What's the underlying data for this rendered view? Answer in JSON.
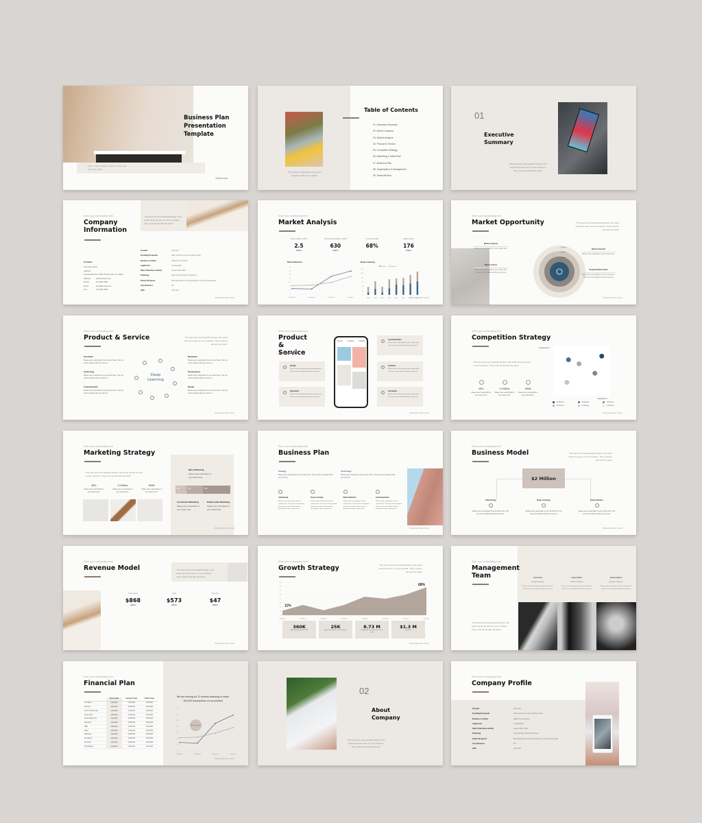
{
  "common": {
    "subheading": "Enter your subheading here",
    "quote": "\"The best and most beautiful things in the world cannot be seen or even touched - They must be felt with the heart\"",
    "footer": "Presentation title / Footer",
    "desc_short": "Please enter a description of your content here.",
    "desc_long": "Please enter a description of your content here. This text can be replaced with your own text.",
    "colors": {
      "accent": "#8a7a6c",
      "blue": "#3f6483",
      "beige": "#ece8e3",
      "taupe": "#b3a69c"
    }
  },
  "slides": {
    "cover": {
      "title": "Business Plan Presentation Template",
      "subtitle": "Enter a slide subtitle or author's name here",
      "date": "March 20, 20XX",
      "logo": "YOUR LOGO"
    },
    "toc": {
      "title": "Table of Contents",
      "caption": "\"The secret to happiness is life is the conviction that we are loved\"",
      "items": [
        "01. Executive Summary",
        "02. About Company",
        "03. Market Analysis",
        "04. Product & Service",
        "05. Competitor Strategy",
        "06. Marketing & Sales Plan",
        "07. Business Plan",
        "08. Organization & Management",
        "09. Financial Plan"
      ]
    },
    "exec": {
      "number": "01",
      "title": "Executive Summary"
    },
    "company_info": {
      "title": "Company Information",
      "contacts_title": "Contacts",
      "contacts": [
        "Company Name",
        "Address",
        "Central Park W & 79th St New York, NY 10024"
      ],
      "contact_rows": [
        [
          "Website",
          "www.domain.com"
        ],
        [
          "Phone",
          "123.456.7890"
        ],
        [
          "Email",
          "email@email.com"
        ],
        [
          "Fax",
          "123.456.7890"
        ]
      ],
      "rows": [
        [
          "Founder",
          "John Doe"
        ],
        [
          "Founding Proposals",
          "Short sentence to your business idea"
        ],
        [
          "Business Location",
          "Address of company"
        ],
        [
          "Legal Form",
          "Incorporated"
        ],
        [
          "Start of Business activity",
          "August 16th, 2010"
        ],
        [
          "Financing",
          "How will the project be financed"
        ],
        [
          "Future Prospects",
          "Brief description to the perspective of your business idea"
        ],
        [
          "Core Business",
          "IoT"
        ],
        [
          "CEO",
          "John Doe"
        ]
      ]
    },
    "market_analysis": {
      "title": "Market Analysis",
      "stats": [
        {
          "label": "Total available market",
          "value": "2.5",
          "unit": "billion"
        },
        {
          "label": "Serviceable available market",
          "value": "630",
          "unit": "million"
        },
        {
          "label": "Conversion Rate",
          "value": "68%",
          "unit": ""
        },
        {
          "label": "Market Share",
          "value": "176",
          "unit": "million"
        }
      ]
    },
    "market_opportunity": {
      "title": "Market Opportunity",
      "ring_labels": [
        "$_Value",
        "$_Value",
        "$_Value"
      ],
      "labels": [
        {
          "title": "Market Capacity",
          "text": "Please enter a description of your content here."
        },
        {
          "title": "Market Volume",
          "text": "Please enter a description of your content here. This text can be replaced with your own text."
        },
        {
          "title": "Market Potential",
          "text": "Please enter a description of your content here."
        },
        {
          "title": "Targeted Market Share",
          "text": "Please enter a description of your content here. This text can be replaced with your own text."
        }
      ]
    },
    "product_service_1": {
      "title": "Product & Service",
      "center": "Deep Learning",
      "left": [
        {
          "title": "Innovation"
        },
        {
          "title": "Technology"
        },
        {
          "title": "Communication"
        }
      ],
      "right": [
        {
          "title": "Motivation"
        },
        {
          "title": "Transparency"
        },
        {
          "title": "Design"
        }
      ]
    },
    "product_service_2": {
      "title": "Product & Service",
      "phone_tabs": [
        "Recent",
        "Trending",
        "Popular"
      ],
      "cards_left": [
        {
          "title": "Design"
        },
        {
          "title": "Interaction"
        }
      ],
      "cards_right": [
        {
          "title": "Communication"
        },
        {
          "title": "Contents"
        },
        {
          "title": "Innovation"
        }
      ]
    },
    "competition": {
      "title": "Competition Strategy",
      "stats": [
        {
          "value": "68%"
        },
        {
          "value": "2.5 Billion"
        },
        {
          "value": "630M"
        }
      ],
      "x_axis": "Categories A",
      "y_axis": "Categories B",
      "legend": [
        "Product A",
        "Product B",
        "Product C",
        "Product D",
        "Product E",
        "Product F"
      ]
    },
    "marketing": {
      "title": "Marketing Strategy",
      "stats": [
        {
          "value": "68%"
        },
        {
          "value": "2.5 Billion"
        },
        {
          "value": "630M"
        }
      ],
      "mass": {
        "title": "Mass Marketing"
      },
      "segments": [
        "20%",
        "30%",
        "50%"
      ],
      "customized": {
        "title": "Customized Marketing"
      },
      "relationship": {
        "title": "Relationship Marketing"
      }
    },
    "business_plan": {
      "title": "Business Plan",
      "top": [
        {
          "title": "Strategy"
        },
        {
          "title": "Technology"
        }
      ],
      "cols": [
        {
          "title": "Advertising"
        },
        {
          "title": "Deep Learning"
        },
        {
          "title": "Data Collection"
        },
        {
          "title": "Communication"
        }
      ]
    },
    "business_model": {
      "title": "Business Model",
      "center": "$2 Million",
      "nodes": [
        {
          "title": "Advertising"
        },
        {
          "title": "Deep Learning"
        },
        {
          "title": "Subscriptions"
        }
      ]
    },
    "revenue": {
      "title": "Revenue Model",
      "stats": [
        {
          "label": "Total Assets",
          "value": "$868",
          "unit": "million"
        },
        {
          "label": "Sales",
          "value": "$573",
          "unit": "million"
        },
        {
          "label": "Revenue",
          "value": "$47",
          "unit": "million"
        }
      ]
    },
    "growth": {
      "title": "Growth Strategy",
      "cards": [
        {
          "value": "360K",
          "label": "App Downloads from 2020"
        },
        {
          "value": "25K",
          "label": "Active subscribers on the platform"
        },
        {
          "value": "8.73 M",
          "label": "Registered transaction in the last year"
        },
        {
          "value": "$1.3 M",
          "label": "Revenue"
        }
      ]
    },
    "management": {
      "title": "Management Team",
      "people": [
        {
          "name": "Lisa Fleck",
          "role": "Design Manager"
        },
        {
          "name": "Dave Baker",
          "role": "Product Designer"
        },
        {
          "name": "Jessica Barry",
          "role": "Software Engineer"
        }
      ]
    },
    "financial": {
      "title": "Financial Plan",
      "headline": "We are looking for 12 months financing to reach 100,000 transactions on our product",
      "bubble": "Break-even point",
      "columns": [
        "",
        "First of Year",
        "Second of Year",
        "Third of Year"
      ],
      "rows": [
        "Unit Sales",
        "Revenue",
        "Cost of Goods Sold",
        "Gross Profit",
        "Gross Margin (%)",
        "Expenses",
        "R&D",
        "Sales",
        "Marketing",
        "Operations",
        "Net Profit",
        "Profit Margin"
      ],
      "cell": "0,000,000"
    },
    "about": {
      "number": "02",
      "title": "About Company"
    },
    "profile": {
      "title": "Company Profile",
      "rows": [
        [
          "Founder",
          "John Doe"
        ],
        [
          "Founding Proposals",
          "Short sentence to your business idea"
        ],
        [
          "Business Location",
          "Address of company"
        ],
        [
          "Legal Form",
          "Incorporated"
        ],
        [
          "Start of Business activity",
          "August 16th, 2010"
        ],
        [
          "Financing",
          "How will the project be financed"
        ],
        [
          "Future Prospects",
          "Brief description to the perspective of your business idea"
        ],
        [
          "Core Business",
          "IoT"
        ],
        [
          "CEO",
          "John Doe"
        ]
      ]
    }
  },
  "chart_data": [
    {
      "type": "line",
      "title": "Data Collection",
      "categories": [
        "Category 1",
        "Category 2",
        "Category 3",
        "Category 4"
      ],
      "ylim": [
        0,
        70
      ],
      "series": [
        {
          "name": "Series 1",
          "values": [
            13,
            12,
            45,
            59
          ],
          "color": "#3f6483"
        },
        {
          "name": "Series 2",
          "values": [
            21,
            22,
            29,
            45
          ],
          "color": "#b3a69c"
        }
      ]
    },
    {
      "type": "bar",
      "title": "Deep Learning",
      "categories": [
        "2020",
        "2021",
        "2022",
        "2023",
        "2024",
        "2025",
        "2026",
        "2027"
      ],
      "ylim": [
        0,
        120
      ],
      "stacked": true,
      "series": [
        {
          "name": "Series 1",
          "values": [
            12,
            28,
            12,
            30,
            48,
            45,
            52,
            62
          ],
          "color": "#3f6483"
        },
        {
          "name": "Series 2",
          "values": [
            25,
            35,
            26,
            42,
            28,
            33,
            40,
            45
          ],
          "color": "#b3a69c"
        }
      ]
    },
    {
      "type": "area",
      "title": "Growth Strategy",
      "categories": [
        "Category 1",
        "Category 2",
        "Category 3",
        "Category 4",
        "Category 5",
        "Category 6",
        "Category 7",
        "Category 8"
      ],
      "ylim": [
        0,
        80
      ],
      "values": [
        11,
        25,
        12,
        25,
        45,
        40,
        50,
        68
      ],
      "annotations": [
        "11%",
        "68%"
      ],
      "color": "#b3a69c"
    },
    {
      "type": "scatter",
      "title": "Competition Strategy",
      "xlabel": "Categories A",
      "ylabel": "Categories B",
      "points": [
        {
          "name": "Product A",
          "x": 88,
          "y": 83,
          "color": "#264a63"
        },
        {
          "name": "Product B",
          "x": 25,
          "y": 75,
          "color": "#4d6f8d"
        },
        {
          "name": "Product C",
          "x": 75,
          "y": 45,
          "color": "#8a8380"
        },
        {
          "name": "Product D",
          "x": 45,
          "y": 66,
          "color": "#b3a69c"
        },
        {
          "name": "Product E",
          "x": 22,
          "y": 25,
          "color": "#cbc3bc"
        },
        {
          "name": "Product F",
          "x": 0,
          "y": 0,
          "color": "#e6e1dc"
        }
      ]
    },
    {
      "type": "line",
      "title": "Financial Plan",
      "categories": [
        "Category 1",
        "Category 2",
        "Category 3",
        "Category 4"
      ],
      "ylim": [
        0,
        70
      ],
      "series": [
        {
          "name": "Series 1",
          "values": [
            13,
            12,
            45,
            59
          ],
          "color": "#3f6483"
        },
        {
          "name": "Series 2",
          "values": [
            21,
            22,
            29,
            38
          ],
          "color": "#b3a69c"
        }
      ]
    }
  ]
}
